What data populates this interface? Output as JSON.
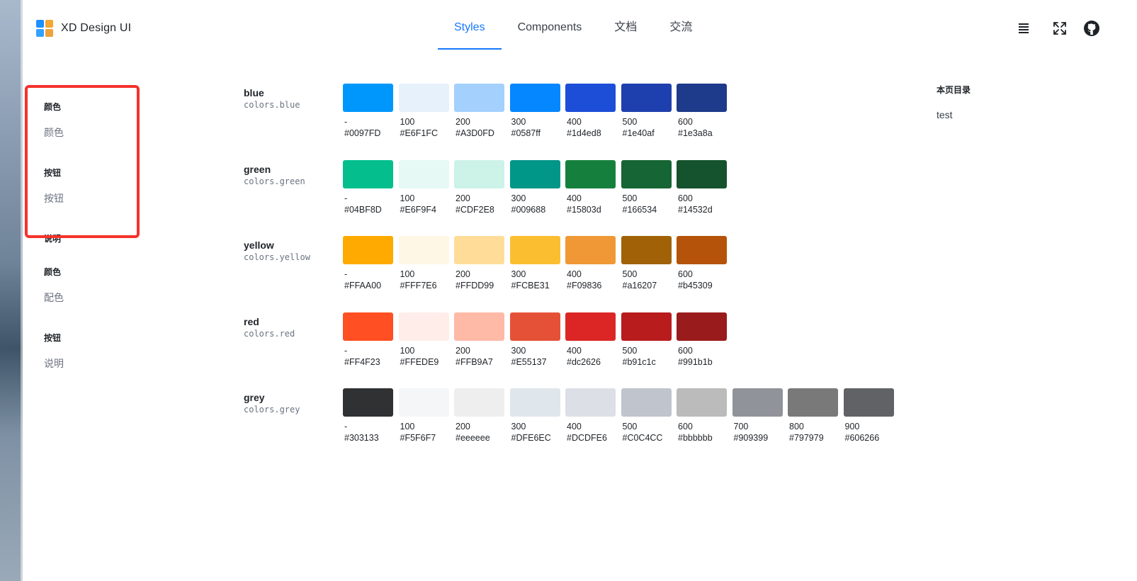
{
  "header": {
    "brand": "XD Design UI",
    "logo_colors": [
      "#1e90ff",
      "#f4a733",
      "#33a2ff",
      "#f0a23a"
    ],
    "nav": [
      {
        "label": "Styles",
        "active": true
      },
      {
        "label": "Components",
        "active": false
      },
      {
        "label": "文档",
        "active": false
      },
      {
        "label": "交流",
        "active": false
      }
    ],
    "icons": [
      "list-menu-icon",
      "fullscreen-icon",
      "github-icon"
    ]
  },
  "sidebar": {
    "items": [
      {
        "kind": "group",
        "label": "颜色"
      },
      {
        "kind": "link",
        "label": "颜色"
      },
      {
        "kind": "group",
        "label": "按钮"
      },
      {
        "kind": "link",
        "label": "按钮"
      },
      {
        "kind": "group",
        "label": "说明"
      },
      {
        "kind": "group",
        "label": "颜色"
      },
      {
        "kind": "link",
        "label": "配色"
      },
      {
        "kind": "group",
        "label": "按钮"
      },
      {
        "kind": "link",
        "label": "说明"
      }
    ],
    "highlight_color": "#f5322b"
  },
  "palettes": [
    {
      "name": "blue",
      "var": "colors.blue",
      "swatches": [
        {
          "shade": "-",
          "hex": "#0097FD"
        },
        {
          "shade": "100",
          "hex": "#E6F1FC"
        },
        {
          "shade": "200",
          "hex": "#A3D0FD"
        },
        {
          "shade": "300",
          "hex": "#0587ff"
        },
        {
          "shade": "400",
          "hex": "#1d4ed8"
        },
        {
          "shade": "500",
          "hex": "#1e40af"
        },
        {
          "shade": "600",
          "hex": "#1e3a8a"
        }
      ]
    },
    {
      "name": "green",
      "var": "colors.green",
      "swatches": [
        {
          "shade": "-",
          "hex": "#04BF8D"
        },
        {
          "shade": "100",
          "hex": "#E6F9F4"
        },
        {
          "shade": "200",
          "hex": "#CDF2E8"
        },
        {
          "shade": "300",
          "hex": "#009688"
        },
        {
          "shade": "400",
          "hex": "#15803d"
        },
        {
          "shade": "500",
          "hex": "#166534"
        },
        {
          "shade": "600",
          "hex": "#14532d"
        }
      ]
    },
    {
      "name": "yellow",
      "var": "colors.yellow",
      "swatches": [
        {
          "shade": "-",
          "hex": "#FFAA00"
        },
        {
          "shade": "100",
          "hex": "#FFF7E6"
        },
        {
          "shade": "200",
          "hex": "#FFDD99"
        },
        {
          "shade": "300",
          "hex": "#FCBE31"
        },
        {
          "shade": "400",
          "hex": "#F09836"
        },
        {
          "shade": "500",
          "hex": "#a16207"
        },
        {
          "shade": "600",
          "hex": "#b45309"
        }
      ]
    },
    {
      "name": "red",
      "var": "colors.red",
      "swatches": [
        {
          "shade": "-",
          "hex": "#FF4F23"
        },
        {
          "shade": "100",
          "hex": "#FFEDE9"
        },
        {
          "shade": "200",
          "hex": "#FFB9A7"
        },
        {
          "shade": "300",
          "hex": "#E55137"
        },
        {
          "shade": "400",
          "hex": "#dc2626"
        },
        {
          "shade": "500",
          "hex": "#b91c1c"
        },
        {
          "shade": "600",
          "hex": "#991b1b"
        }
      ]
    },
    {
      "name": "grey",
      "var": "colors.grey",
      "swatches": [
        {
          "shade": "-",
          "hex": "#303133"
        },
        {
          "shade": "100",
          "hex": "#F5F6F7"
        },
        {
          "shade": "200",
          "hex": "#eeeeee"
        },
        {
          "shade": "300",
          "hex": "#DFE6EC"
        },
        {
          "shade": "400",
          "hex": "#DCDFE6"
        },
        {
          "shade": "500",
          "hex": "#C0C4CC"
        },
        {
          "shade": "600",
          "hex": "#bbbbbb"
        },
        {
          "shade": "700",
          "hex": "#909399"
        },
        {
          "shade": "800",
          "hex": "#797979"
        },
        {
          "shade": "900",
          "hex": "#606266"
        }
      ]
    }
  ],
  "toc": {
    "title": "本页目录",
    "items": [
      "test"
    ]
  }
}
